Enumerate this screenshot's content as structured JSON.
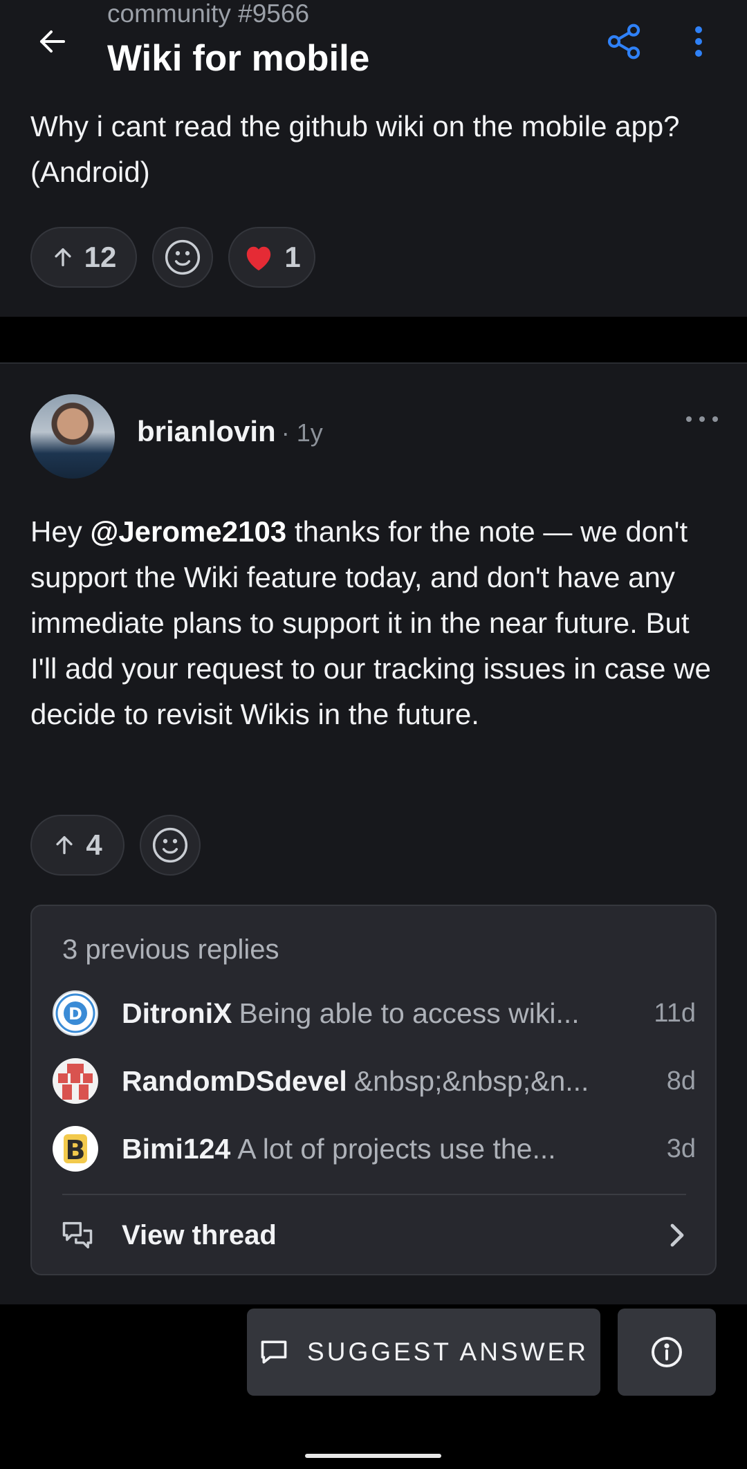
{
  "header": {
    "subtitle": "community #9566",
    "title": "Wiki for mobile"
  },
  "question": {
    "body": "Why i cant read the github wiki on the mobile app? (Android)",
    "upvotes": "12",
    "heart_count": "1"
  },
  "answer": {
    "author": "brianlovin",
    "time": "· 1y",
    "body_prefix": "Hey ",
    "mention": "@Jerome2103",
    "body_rest": " thanks for the note — we don't support the Wiki feature today, and don't have any immediate plans to support it in the near future. But I'll add your request to our tracking issues in case we decide to revisit Wikis in the future.",
    "upvotes": "4"
  },
  "replies": {
    "title": "3 previous replies",
    "items": [
      {
        "user": "DitroniX",
        "snippet": "Being able to access wiki...",
        "time": "11d"
      },
      {
        "user": "RandomDSdevel",
        "snippet": "&nbsp;&nbsp;&n...",
        "time": "8d"
      },
      {
        "user": "Bimi124",
        "snippet": "A lot of projects use the...",
        "time": "3d"
      }
    ],
    "view_thread": "View thread"
  },
  "bottom": {
    "suggest_label": "SUGGEST ANSWER"
  },
  "colors": {
    "background": "#17181c",
    "accent": "#2f81f7",
    "text": "#f2f3f5",
    "muted": "#9ba0a8"
  }
}
